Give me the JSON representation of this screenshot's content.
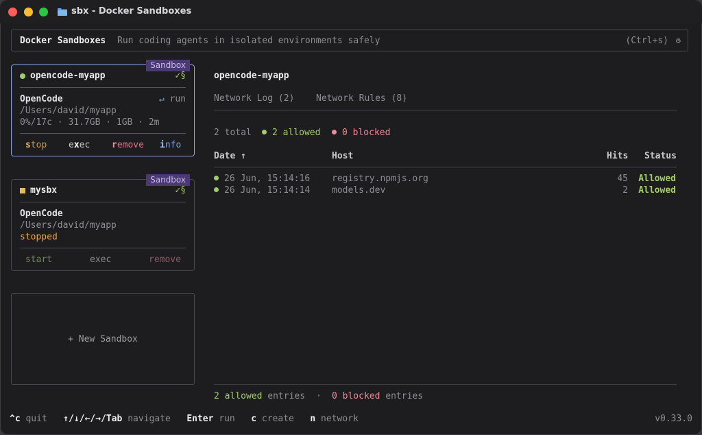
{
  "window": {
    "title": "sbx - Docker Sandboxes",
    "icon": "folder-icon"
  },
  "header": {
    "title": "Docker Sandboxes",
    "subtitle": "Run coding agents in isolated environments safely",
    "shortcut": "(Ctrl+s)",
    "gear": "⚙"
  },
  "sandboxes": [
    {
      "tag": "Sandbox",
      "name": "opencode-myapp",
      "check": "✓§",
      "agent": "OpenCode",
      "run_arrow": "↵",
      "run_label": "run",
      "path": "/Users/david/myapp",
      "stats": "0%/17c · 31.7GB · 1GB · 2m",
      "actions": {
        "stop_hk": "s",
        "stop_rest": "top",
        "exec_a": "e",
        "exec_hk": "x",
        "exec_rest": "ec",
        "remove_hk": "r",
        "remove_rest": "emove",
        "info_hk": "i",
        "info_rest": "nfo"
      }
    },
    {
      "tag": "Sandbox",
      "name": "mysbx",
      "check": "✓§",
      "agent": "OpenCode",
      "path": "/Users/david/myapp",
      "status": "stopped",
      "actions": {
        "start": "start",
        "exec": "exec",
        "remove": "remove"
      }
    }
  ],
  "new_sandbox": "+ New Sandbox",
  "detail": {
    "title": "opencode-myapp",
    "tabs": [
      "Network Log (2)",
      "Network Rules (8)"
    ],
    "summary": {
      "total": "2 total",
      "allowed": "2 allowed",
      "blocked": "0 blocked"
    },
    "columns": {
      "date": "Date ↑",
      "host": "Host",
      "hits": "Hits",
      "status": "Status"
    },
    "rows": [
      {
        "date": "26 Jun, 15:14:16",
        "host": "registry.npmjs.org",
        "hits": "45",
        "status": "Allowed"
      },
      {
        "date": "26 Jun, 15:14:14",
        "host": "models.dev",
        "hits": "2",
        "status": "Allowed"
      }
    ],
    "footer": {
      "allowed": "2 allowed",
      "allowed_suffix": "entries",
      "sep": "·",
      "blocked": "0 blocked",
      "blocked_suffix": "entries"
    }
  },
  "shortcuts": [
    {
      "key": "^c",
      "label": "quit"
    },
    {
      "key": "↑/↓/←/→/Tab",
      "label": "navigate"
    },
    {
      "key": "Enter",
      "label": "run"
    },
    {
      "key": "c",
      "label": "create"
    },
    {
      "key": "n",
      "label": "network"
    }
  ],
  "version": "v0.33.0",
  "colors": {
    "accent": "#8aa5e3",
    "allowed": "#a4cc6e",
    "blocked": "#ef8a98",
    "tag_bg": "#4b3a72"
  }
}
